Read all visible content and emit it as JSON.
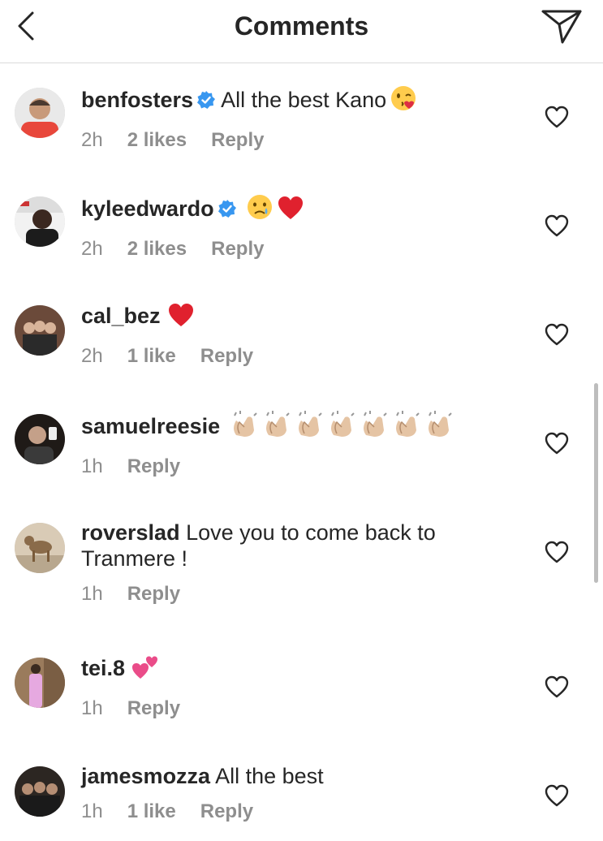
{
  "header": {
    "title": "Comments",
    "back_icon": "chevron-left-icon",
    "send_icon": "paper-plane-icon"
  },
  "colors": {
    "text": "#262626",
    "muted": "#8e8e8e",
    "verified": "#3897f0",
    "divider": "#dbdbdb"
  },
  "comments": [
    {
      "username": "benfosters",
      "verified": true,
      "text": "All the best Kano",
      "emojis": [
        "kissing-face-emoji"
      ],
      "time": "2h",
      "likes": "2 likes",
      "reply": "Reply"
    },
    {
      "username": "kyleedwardo",
      "verified": true,
      "text": "",
      "emojis": [
        "crying-face-emoji",
        "red-heart-emoji"
      ],
      "time": "2h",
      "likes": "2 likes",
      "reply": "Reply"
    },
    {
      "username": "cal_bez",
      "verified": false,
      "text": "",
      "emojis": [
        "red-heart-emoji"
      ],
      "time": "2h",
      "likes": "1 like",
      "reply": "Reply"
    },
    {
      "username": "samuelreesie",
      "verified": false,
      "text": "",
      "emojis": [
        "clapping-hands-emoji",
        "clapping-hands-emoji",
        "clapping-hands-emoji",
        "clapping-hands-emoji",
        "clapping-hands-emoji",
        "clapping-hands-emoji",
        "clapping-hands-emoji"
      ],
      "time": "1h",
      "likes": "",
      "reply": "Reply"
    },
    {
      "username": "roverslad",
      "verified": false,
      "text": "Love you to come back to",
      "text_line2": "Tranmere !",
      "emojis": [],
      "time": "1h",
      "likes": "",
      "reply": "Reply"
    },
    {
      "username": "tei.8",
      "verified": false,
      "text": "",
      "emojis": [
        "two-hearts-emoji"
      ],
      "time": "1h",
      "likes": "",
      "reply": "Reply"
    },
    {
      "username": "jamesmozza",
      "verified": false,
      "text": "All the best",
      "emojis": [],
      "time": "1h",
      "likes": "1 like",
      "reply": "Reply"
    }
  ]
}
